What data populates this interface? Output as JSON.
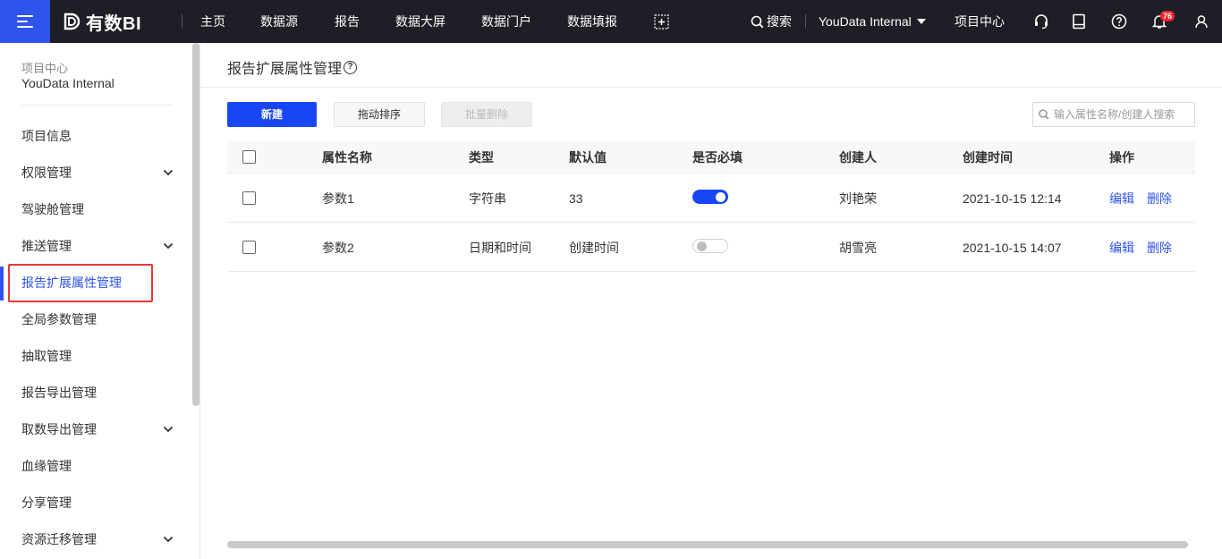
{
  "topbar": {
    "logo_text": "有数BI",
    "nav": [
      {
        "label": "主页",
        "name": "nav-home"
      },
      {
        "label": "数据源",
        "name": "nav-datasource"
      },
      {
        "label": "报告",
        "name": "nav-report"
      },
      {
        "label": "数据大屏",
        "name": "nav-bigscreen"
      },
      {
        "label": "数据门户",
        "name": "nav-portal"
      },
      {
        "label": "数据填报",
        "name": "nav-fill"
      }
    ],
    "search_label": "搜索",
    "project_select": "YouData Internal",
    "project_center": "项目中心",
    "notification_count": "76"
  },
  "sidebar": {
    "project_label": "项目中心",
    "project_name": "YouData Internal",
    "items": [
      {
        "label": "项目信息",
        "expandable": false
      },
      {
        "label": "权限管理",
        "expandable": true
      },
      {
        "label": "驾驶舱管理",
        "expandable": false
      },
      {
        "label": "推送管理",
        "expandable": true
      },
      {
        "label": "报告扩展属性管理",
        "expandable": false,
        "active": true
      },
      {
        "label": "全局参数管理",
        "expandable": false
      },
      {
        "label": "抽取管理",
        "expandable": false
      },
      {
        "label": "报告导出管理",
        "expandable": false
      },
      {
        "label": "取数导出管理",
        "expandable": true
      },
      {
        "label": "血缘管理",
        "expandable": false
      },
      {
        "label": "分享管理",
        "expandable": false
      },
      {
        "label": "资源迁移管理",
        "expandable": true
      }
    ]
  },
  "main": {
    "title": "报告扩展属性管理",
    "toolbar": {
      "new_label": "新建",
      "sort_label": "拖动排序",
      "batch_delete_label": "批量删除"
    },
    "search_placeholder": "输入属性名称/创建人搜索",
    "table": {
      "headers": [
        "属性名称",
        "类型",
        "默认值",
        "是否必填",
        "创建人",
        "创建时间",
        "操作"
      ],
      "rows": [
        {
          "name": "参数1",
          "type": "字符串",
          "default": "33",
          "required": true,
          "creator": "刘艳荣",
          "created": "2021-10-15 12:14",
          "edit": "编辑",
          "delete": "删除"
        },
        {
          "name": "参数2",
          "type": "日期和时间",
          "default": "创建时间",
          "required": false,
          "creator": "胡雪亮",
          "created": "2021-10-15 14:07",
          "edit": "编辑",
          "delete": "删除"
        }
      ]
    }
  },
  "colors": {
    "accent": "#2f54eb",
    "primary_button": "#1846f5",
    "topbar_bg": "#1e1f26",
    "highlight_border": "#e53935",
    "badge": "#f5222d"
  }
}
